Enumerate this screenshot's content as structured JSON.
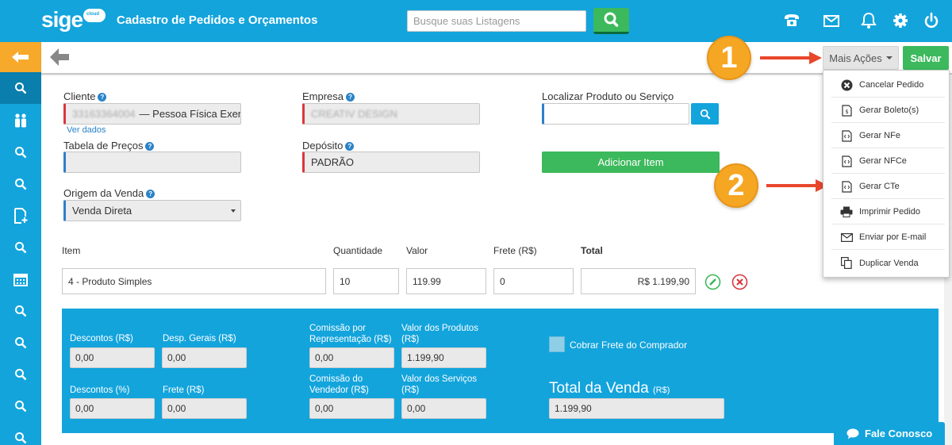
{
  "header": {
    "logo_text": "sige",
    "logo_badge": "cloud",
    "title": "Cadastro de Pedidos e Orçamentos",
    "search_placeholder": "Busque suas Listagens",
    "icons": [
      "search-icon",
      "phone-icon",
      "mail-icon",
      "bell-icon",
      "gear-icon",
      "power-icon"
    ]
  },
  "sidebar": {
    "items": [
      "back-arrow-icon",
      "search-icon",
      "people-icon",
      "search-icon",
      "search-icon",
      "document-add-icon",
      "search-icon",
      "calendar-icon",
      "search-icon",
      "search-icon",
      "search-icon",
      "search-icon",
      "search-icon"
    ]
  },
  "toolbar": {
    "mais_acoes_label": "Mais Ações",
    "salvar_label": "Salvar"
  },
  "callouts": {
    "one": "1",
    "two": "2"
  },
  "form": {
    "cliente_label": "Cliente",
    "cliente_id_blurred": "33163364004",
    "cliente_value": "— Pessoa Física Exem",
    "ver_dados": "Ver dados",
    "empresa_label": "Empresa",
    "empresa_value_blurred": "CREATIV DESIGN",
    "localizar_label": "Localizar Produto ou Serviço",
    "localizar_value": "",
    "tabela_label": "Tabela de Preços",
    "tabela_value": "",
    "deposito_label": "Depósito",
    "deposito_value": "PADRÃO",
    "adicionar_label": "Adicionar Item",
    "origem_label": "Origem da Venda",
    "origem_value": "Venda Direta"
  },
  "items": {
    "headers": {
      "item": "Item",
      "quantidade": "Quantidade",
      "valor": "Valor",
      "frete": "Frete (R$)",
      "total": "Total"
    },
    "row": {
      "item": "4 - Produto Simples",
      "quantidade": "10",
      "valor": "119.99",
      "frete": "0",
      "total": "R$ 1.199,90"
    }
  },
  "totals": {
    "descontos_rs_label": "Descontos (R$)",
    "descontos_rs": "0,00",
    "desp_gerais_label": "Desp. Gerais (R$)",
    "desp_gerais": "0,00",
    "comissao_rep_label_1": "Comissão por",
    "comissao_rep_label_2": "Representação (R$)",
    "comissao_rep": "0,00",
    "valor_produtos_label_1": "Valor dos Produtos",
    "valor_produtos_label_2": "(R$)",
    "valor_produtos": "1.199,90",
    "descontos_pct_label": "Descontos (%)",
    "descontos_pct": "0,00",
    "frete_label": "Frete (R$)",
    "frete": "0,00",
    "comissao_vend_label_1": "Comissão do",
    "comissao_vend_label_2": "Vendedor (R$)",
    "comissao_vend": "0,00",
    "valor_servicos_label_1": "Valor dos Serviços",
    "valor_servicos_label_2": "(R$)",
    "valor_servicos": "0,00",
    "cobrar_frete_label": "Cobrar Frete do Comprador",
    "total_venda_label": "Total da Venda",
    "total_venda_unit": "(R$)",
    "total_venda": "1.199,90"
  },
  "dropdown": {
    "items": [
      {
        "label": "Cancelar Pedido",
        "icon": "cancel-circle-icon"
      },
      {
        "label": "Gerar Boleto(s)",
        "icon": "boleto-doc-icon"
      },
      {
        "label": "Gerar NFe",
        "icon": "code-doc-icon"
      },
      {
        "label": "Gerar NFCe",
        "icon": "code-doc-icon"
      },
      {
        "label": "Gerar CTe",
        "icon": "code-doc-icon"
      },
      {
        "label": "Imprimir Pedido",
        "icon": "printer-icon"
      },
      {
        "label": "Enviar por E-mail",
        "icon": "envelope-icon"
      },
      {
        "label": "Duplicar Venda",
        "icon": "copy-icon"
      }
    ]
  },
  "chat": {
    "label": "Fale Conosco"
  },
  "colors": {
    "primary": "#13a4dc",
    "green": "#3cb95c",
    "accent": "#f7a92b",
    "required": "#d9373c",
    "arrow": "#e8472b"
  }
}
